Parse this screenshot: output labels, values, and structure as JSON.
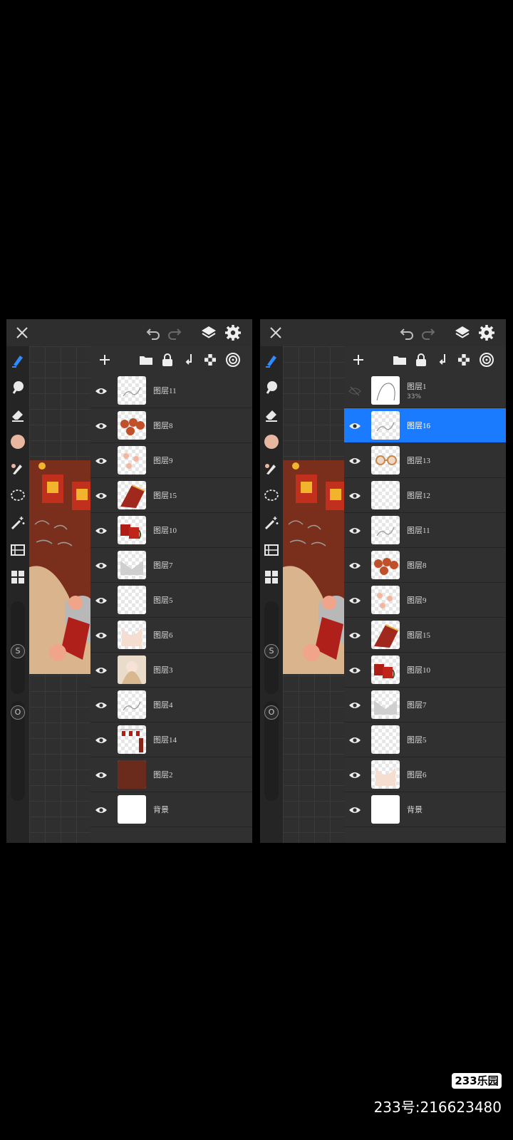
{
  "watermark": {
    "logo": "233乐园",
    "id": "233号:216623480"
  },
  "colors": {
    "selected": "#1a7bff",
    "panel": "#2b2b2b",
    "layer_row": "#303030",
    "brush_color": "#e8b7a0"
  },
  "left": {
    "layers": [
      {
        "name": "图层11",
        "visible": true,
        "thumb": "sketch"
      },
      {
        "name": "图层8",
        "visible": true,
        "thumb": "coins"
      },
      {
        "name": "图层9",
        "visible": true,
        "thumb": "flowers"
      },
      {
        "name": "图层15",
        "visible": true,
        "thumb": "fan"
      },
      {
        "name": "图层10",
        "visible": true,
        "thumb": "envelopes"
      },
      {
        "name": "图层7",
        "visible": true,
        "thumb": "gray"
      },
      {
        "name": "图层5",
        "visible": true,
        "thumb": "blank"
      },
      {
        "name": "图层6",
        "visible": true,
        "thumb": "body"
      },
      {
        "name": "图层3",
        "visible": true,
        "thumb": "girl"
      },
      {
        "name": "图层4",
        "visible": true,
        "thumb": "sketch"
      },
      {
        "name": "图层14",
        "visible": true,
        "thumb": "banner"
      },
      {
        "name": "图层2",
        "visible": true,
        "thumb": "brown"
      },
      {
        "name": "背景",
        "visible": true,
        "thumb": "white"
      }
    ]
  },
  "right": {
    "layers": [
      {
        "name": "图层1",
        "opacity": "33%",
        "visible": false,
        "thumb": "lineart"
      },
      {
        "name": "图层16",
        "visible": true,
        "selected": true,
        "thumb": "sketch"
      },
      {
        "name": "图层13",
        "visible": true,
        "thumb": "glasses"
      },
      {
        "name": "图层12",
        "visible": true,
        "thumb": "blank"
      },
      {
        "name": "图层11",
        "visible": true,
        "thumb": "sketch"
      },
      {
        "name": "图层8",
        "visible": true,
        "thumb": "coins"
      },
      {
        "name": "图层9",
        "visible": true,
        "thumb": "flowers"
      },
      {
        "name": "图层15",
        "visible": true,
        "thumb": "fan"
      },
      {
        "name": "图层10",
        "visible": true,
        "thumb": "envelopes"
      },
      {
        "name": "图层7",
        "visible": true,
        "thumb": "gray"
      },
      {
        "name": "图层5",
        "visible": true,
        "thumb": "blank"
      },
      {
        "name": "图层6",
        "visible": true,
        "thumb": "body"
      },
      {
        "name": "背景",
        "visible": true,
        "thumb": "white"
      }
    ]
  },
  "sliders": {
    "size_label": "S",
    "opacity_label": "O"
  },
  "icons": {
    "topbar": [
      "close-icon",
      "undo-icon",
      "redo-icon",
      "layers-icon",
      "settings-icon"
    ],
    "layer_header": [
      "add-layer-icon",
      "folder-icon",
      "lock-icon",
      "merge-down-icon",
      "transparency-icon",
      "layer-mode-icon"
    ],
    "tools": [
      "brush-icon",
      "smudge-icon",
      "eraser-icon",
      "color-icon",
      "fill-icon",
      "lasso-icon",
      "magic-wand-icon",
      "adjust-icon",
      "gallery-icon"
    ]
  }
}
